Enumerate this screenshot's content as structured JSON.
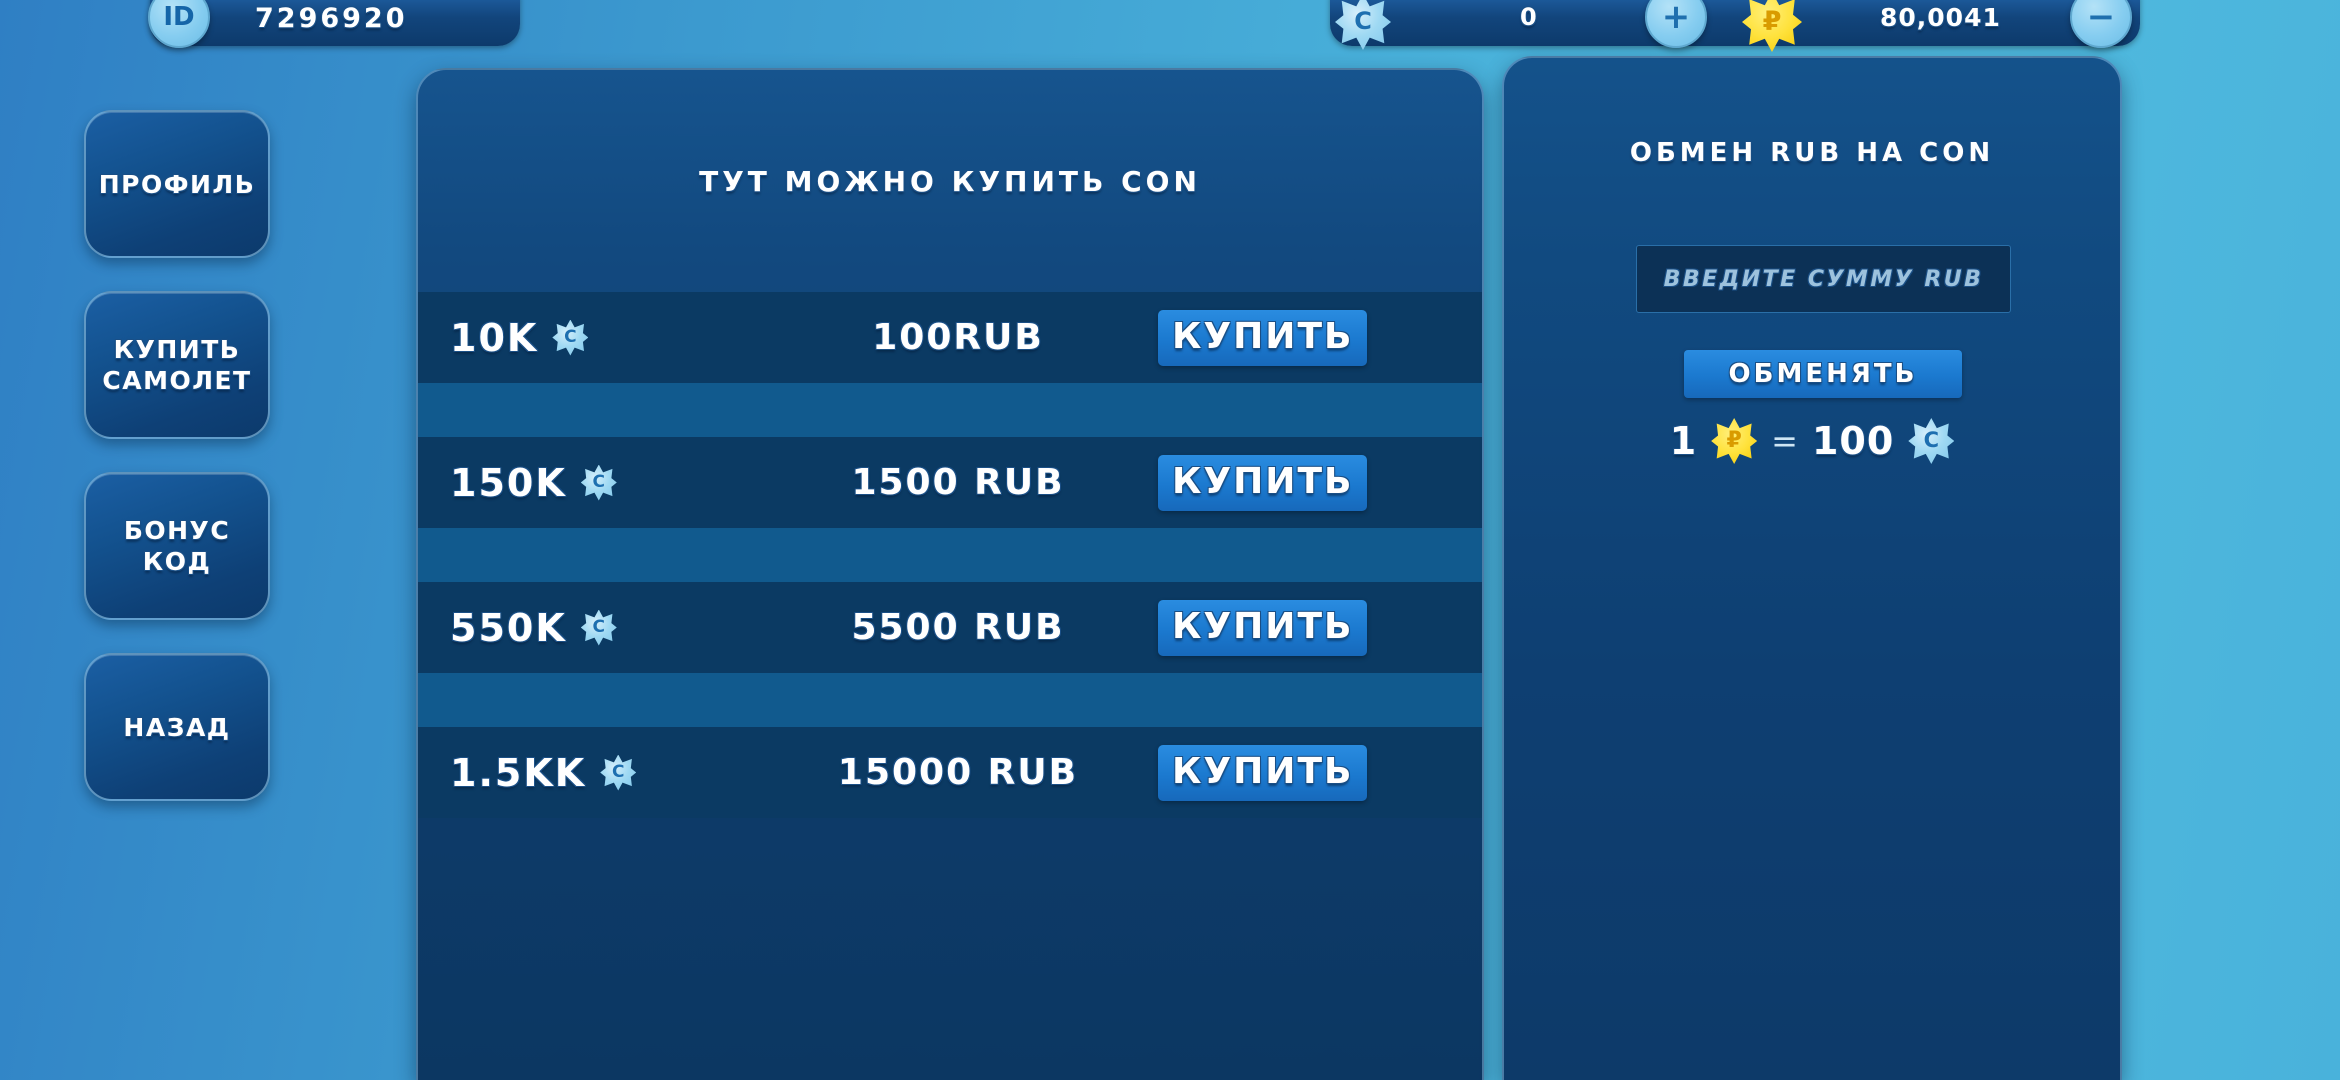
{
  "topbar": {
    "id_badge_icon": "id-icon",
    "id_badge_label": "ID",
    "player_id": "7296920",
    "con_icon": "con-coin-icon",
    "con_balance": "0",
    "plus_icon": "plus-icon",
    "plus_label": "+",
    "rub_icon": "rub-star-icon",
    "rub_symbol": "₽",
    "rub_balance": "80,0041",
    "minus_icon": "minus-icon",
    "minus_label": "−"
  },
  "sidebar": {
    "items": [
      {
        "label": "ПРОФИЛЬ",
        "name": "sidebar-item-profile"
      },
      {
        "label": "КУПИТЬ\nСАМОЛЕТ",
        "name": "sidebar-item-buy-plane"
      },
      {
        "label": "БОНУС\nКОД",
        "name": "sidebar-item-bonus-code"
      },
      {
        "label": "НАЗАД",
        "name": "sidebar-item-back"
      }
    ]
  },
  "shop": {
    "title": "ТУТ МОЖНО КУПИТЬ CON",
    "buy_label": "КУПИТЬ",
    "coin_symbol": "C",
    "rows": [
      {
        "amount": "10K",
        "price": "100RUB",
        "buy": "КУПИТЬ"
      },
      {
        "amount": "150K",
        "price": "1500 RUB",
        "buy": "КУПИТЬ"
      },
      {
        "amount": "550K",
        "price": "5500 RUB",
        "buy": "КУПИТЬ"
      },
      {
        "amount": "1.5KK",
        "price": "15000 RUB",
        "buy": "КУПИТЬ"
      }
    ]
  },
  "exchange": {
    "title": "ОБМЕН RUB НА CON",
    "input_placeholder": "ВВЕДИТЕ СУММУ RUB",
    "input_value": "",
    "button_label": "ОБМЕНЯТЬ",
    "rate_left_amount": "1",
    "rate_left_symbol": "₽",
    "rate_equals": "=",
    "rate_right_amount": "100",
    "rate_right_symbol": "C"
  },
  "colors": {
    "background_left": "#2f7fc4",
    "background_right": "#4bb4dc",
    "panel_dark": "#0c3762",
    "row_dark": "#0b3a63",
    "row_light": "#115a8e",
    "accent_button": "#1b79cf",
    "coin_con": "#9fd9f3",
    "coin_rub": "#ffe23c"
  }
}
